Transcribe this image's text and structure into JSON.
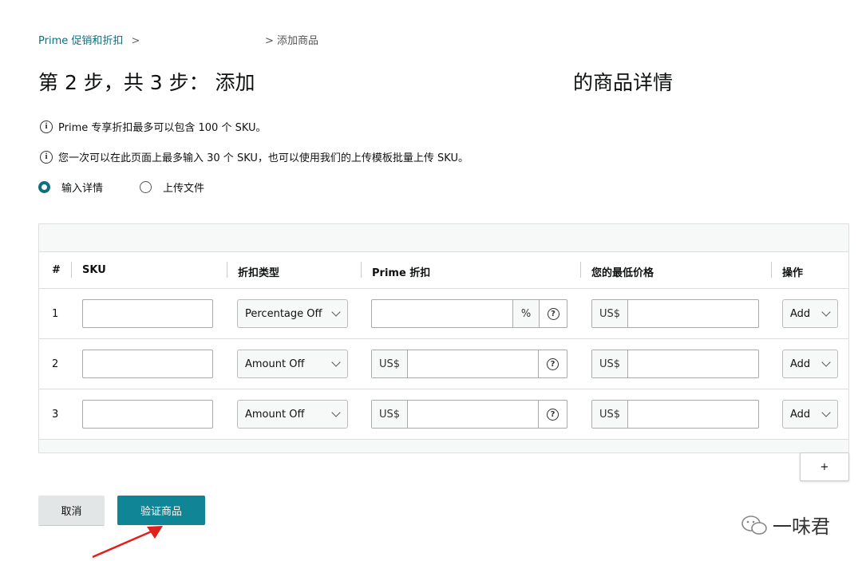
{
  "breadcrumb": {
    "root": "Prime 促销和折扣",
    "separator": ">",
    "current": "添加商品"
  },
  "heading": {
    "left": "第 2 步，共 3 步： 添加",
    "right": "的商品详情"
  },
  "notices": [
    "Prime 专享折扣最多可以包含 100 个 SKU。",
    "您一次可以在此页面上最多输入 30 个 SKU，也可以使用我们的上传模板批量上传 SKU。"
  ],
  "mode": {
    "options": [
      "输入详情",
      "上传文件"
    ],
    "selected": "输入详情"
  },
  "table": {
    "headers": [
      "#",
      "SKU",
      "折扣类型",
      "Prime 折扣",
      "您的最低价格",
      "操作"
    ],
    "rows": [
      {
        "index": "1",
        "sku": "",
        "discount_type": "Percentage Off",
        "discount_value": "",
        "discount_affix": "%",
        "min_price_prefix": "US$",
        "min_price": "",
        "action": "Add"
      },
      {
        "index": "2",
        "sku": "",
        "discount_type": "Amount Off",
        "discount_value": "",
        "discount_affix": "US$",
        "min_price_prefix": "US$",
        "min_price": "",
        "action": "Add"
      },
      {
        "index": "3",
        "sku": "",
        "discount_type": "Amount Off",
        "discount_value": "",
        "discount_affix": "US$",
        "min_price_prefix": "US$",
        "min_price": "",
        "action": "Add"
      }
    ],
    "add_row_label": "+"
  },
  "buttons": {
    "cancel": "取消",
    "verify": "验证商品"
  },
  "watermark": "一味君",
  "icons": {
    "info": "info-circle-icon",
    "help": "question-circle-icon",
    "dropdown": "chevron-down-icon",
    "annotation": "red-arrow-icon"
  },
  "colors": {
    "primary": "#0f8595",
    "link": "#0f6f7d",
    "annotation_arrow": "#e0201c"
  }
}
